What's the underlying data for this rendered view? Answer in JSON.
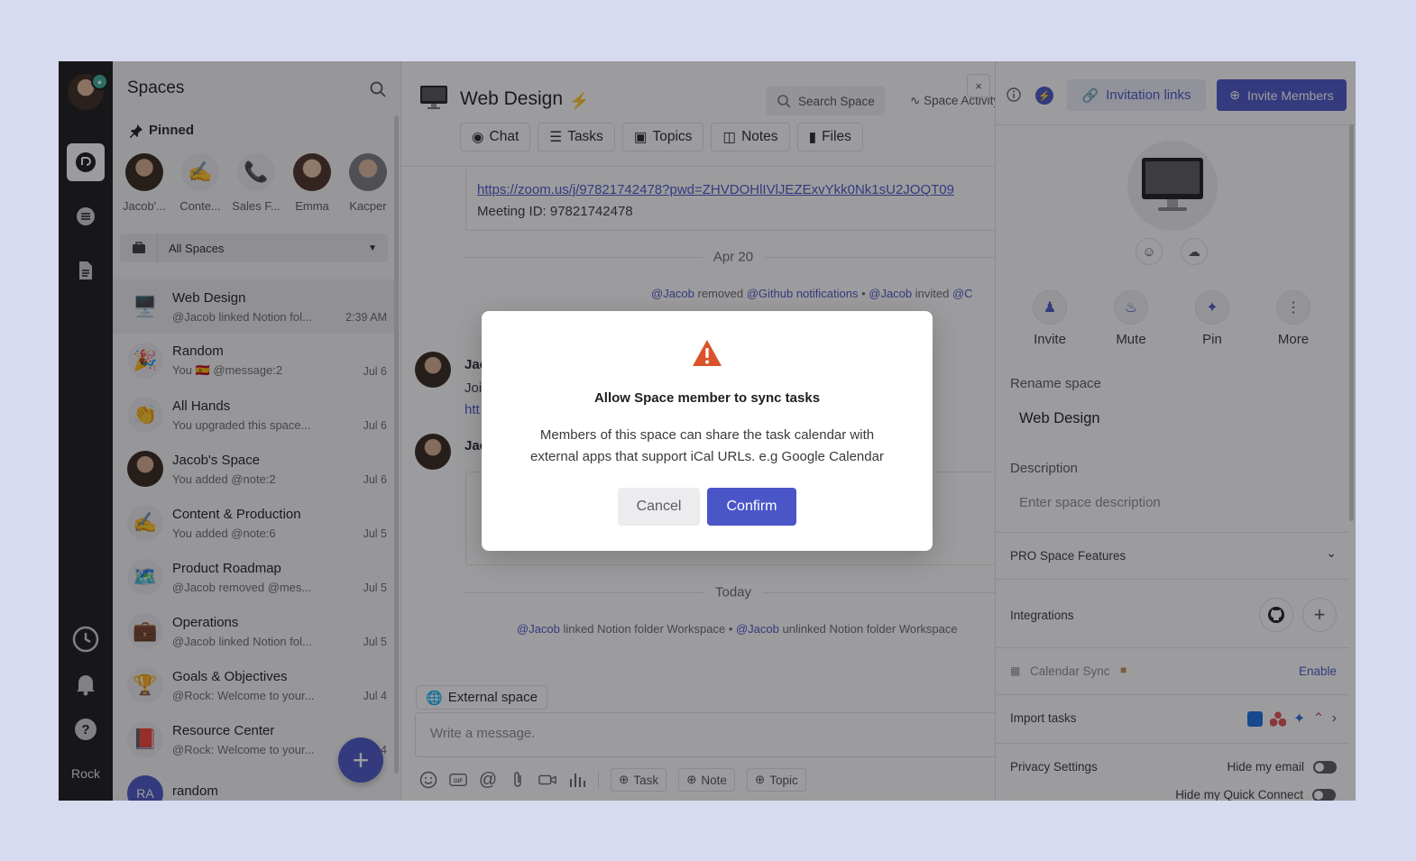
{
  "rail": {
    "label": "Rock",
    "badge": "✶"
  },
  "spaces": {
    "title": "Spaces",
    "pinned_label": "Pinned",
    "pinned": [
      {
        "name": "Jacob'...",
        "icon": "🧔"
      },
      {
        "name": "Conte...",
        "icon": "✍️"
      },
      {
        "name": "Sales F...",
        "icon": "📞"
      },
      {
        "name": "Emma",
        "icon": "👩"
      },
      {
        "name": "Kacper",
        "icon": "👨"
      }
    ],
    "filter": "All Spaces",
    "items": [
      {
        "name": "Web Design",
        "preview": "@Jacob linked Notion fol...",
        "date": "2:39 AM",
        "icon": "🖥️"
      },
      {
        "name": "Random",
        "preview": "You 🇪🇸 @message:2",
        "date": "Jul 6",
        "icon": "🎉"
      },
      {
        "name": "All Hands",
        "preview": "You upgraded this space...",
        "date": "Jul 6",
        "icon": "👏"
      },
      {
        "name": "Jacob's Space",
        "preview": "You added @note:2",
        "date": "Jul 6",
        "icon": "🧔"
      },
      {
        "name": "Content & Production",
        "preview": "You added @note:6",
        "date": "Jul 5",
        "icon": "✍️"
      },
      {
        "name": "Product Roadmap",
        "preview": "@Jacob removed @mes...",
        "date": "Jul 5",
        "icon": "🗺️"
      },
      {
        "name": "Operations",
        "preview": "@Jacob linked Notion fol...",
        "date": "Jul 5",
        "icon": "💼"
      },
      {
        "name": "Goals & Objectives",
        "preview": "@Rock: Welcome to your...",
        "date": "Jul 4",
        "icon": "🏆"
      },
      {
        "name": "Resource Center",
        "preview": "@Rock: Welcome to your...",
        "date": "Jul 4",
        "icon": "📕"
      },
      {
        "name": "random",
        "preview": "",
        "date": "",
        "icon": "RA"
      }
    ],
    "fab": "+"
  },
  "main": {
    "title": "Web Design",
    "search": "Search Space",
    "activity": "Space Activity",
    "close": "×",
    "tabs": [
      "Chat",
      "Tasks",
      "Topics",
      "Notes",
      "Files"
    ],
    "zoom_link": "https://zoom.us/j/97821742478?pwd=ZHVDOHlIVlJEZExvYkk0Nk1sU2JOQT09",
    "meeting_id": "Meeting ID: 97821742478",
    "day1": "Apr 20",
    "sys1": {
      "a": "@Jacob",
      "b": " removed ",
      "c": "@Github notifications",
      "d": " • ",
      "e": "@Jacob",
      "f": " invited ",
      "g": "@C"
    },
    "msg1_name": "Jac",
    "msg1_line1": "Joi",
    "msg1_line2": "htt",
    "msg2_name": "Jac",
    "day2": "Today",
    "sys2": {
      "a": "@Jacob",
      "b": " linked Notion folder Workspace ",
      "c": " • ",
      "d": "@Jacob",
      "e": " unlinked Notion folder Workspace"
    },
    "external": "External space",
    "composer_placeholder": "Write a message.",
    "pills": [
      "Task",
      "Note",
      "Topic"
    ]
  },
  "right": {
    "invitation_links": "Invitation links",
    "invite_members": "Invite Members",
    "actions": [
      "Invite",
      "Mute",
      "Pin",
      "More"
    ],
    "rename_label": "Rename space",
    "space_name": "Web Design",
    "description_label": "Description",
    "description_placeholder": "Enter space description",
    "pro_features": "PRO Space Features",
    "integrations": "Integrations",
    "calendar_sync": "Calendar Sync",
    "enable": "Enable",
    "import_tasks": "Import tasks",
    "privacy": "Privacy Settings",
    "hide_email": "Hide my email",
    "hide_qc": "Hide my Quick Connect"
  },
  "modal": {
    "title": "Allow Space member to sync tasks",
    "body": "Members of this space can share the task calendar with external apps that support iCal URLs. e.g Google Calendar",
    "cancel": "Cancel",
    "confirm": "Confirm"
  },
  "colors": {
    "accent": "#4a56c8",
    "warning": "#d9542a",
    "rail": "#1a1a1c",
    "backdrop": "#d6dbef"
  }
}
